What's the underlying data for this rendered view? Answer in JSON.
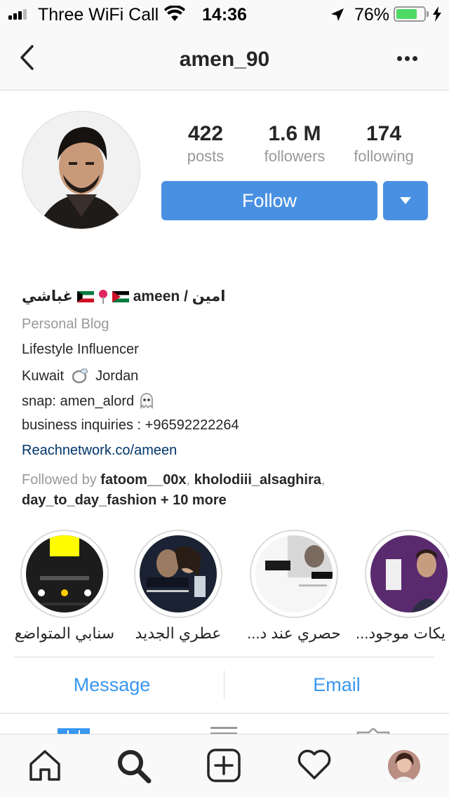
{
  "status_bar": {
    "carrier": "Three WiFi Call",
    "time": "14:36",
    "battery": "76%",
    "battery_level": 0.76
  },
  "nav": {
    "title": "amen_90",
    "icons": [
      "back-chevron-icon",
      "more-dots-icon"
    ]
  },
  "profile": {
    "posts_count": "422",
    "posts_label": "posts",
    "followers_count": "1.6 M",
    "followers_label": "followers",
    "following_count": "174",
    "following_label": "following",
    "follow_label": "Follow",
    "follow_color": "#4a90e2"
  },
  "bio": {
    "name_left": "غباشي",
    "name_right": "ameen / امين",
    "category": "Personal Blog",
    "line1": "Lifestyle Influencer",
    "line2_a": "Kuwait",
    "line2_b": "Jordan",
    "line3": "snap: amen_alord",
    "line4": "business inquiries : +96592222264",
    "link": "Reachnetwork.co/ameen",
    "followed_by_prefix": "Followed by",
    "followed_user1": "fatoom__00x",
    "followed_user2": "kholodiii_alsaghira",
    "followed_user3": "day_to_day_fashion",
    "followed_more": "+ 10 more"
  },
  "highlights": [
    {
      "label": "سنابي المتواضع"
    },
    {
      "label": "عطري الجديد"
    },
    {
      "label": "حصري عند د..."
    },
    {
      "label": "يكات موجود..."
    }
  ],
  "contact": {
    "message_label": "Message",
    "email_label": "Email",
    "color": "#3897f0"
  },
  "tabbar": {
    "icons": [
      "home-icon",
      "search-icon",
      "add-post-icon",
      "activity-heart-icon",
      "profile-avatar-icon"
    ]
  }
}
